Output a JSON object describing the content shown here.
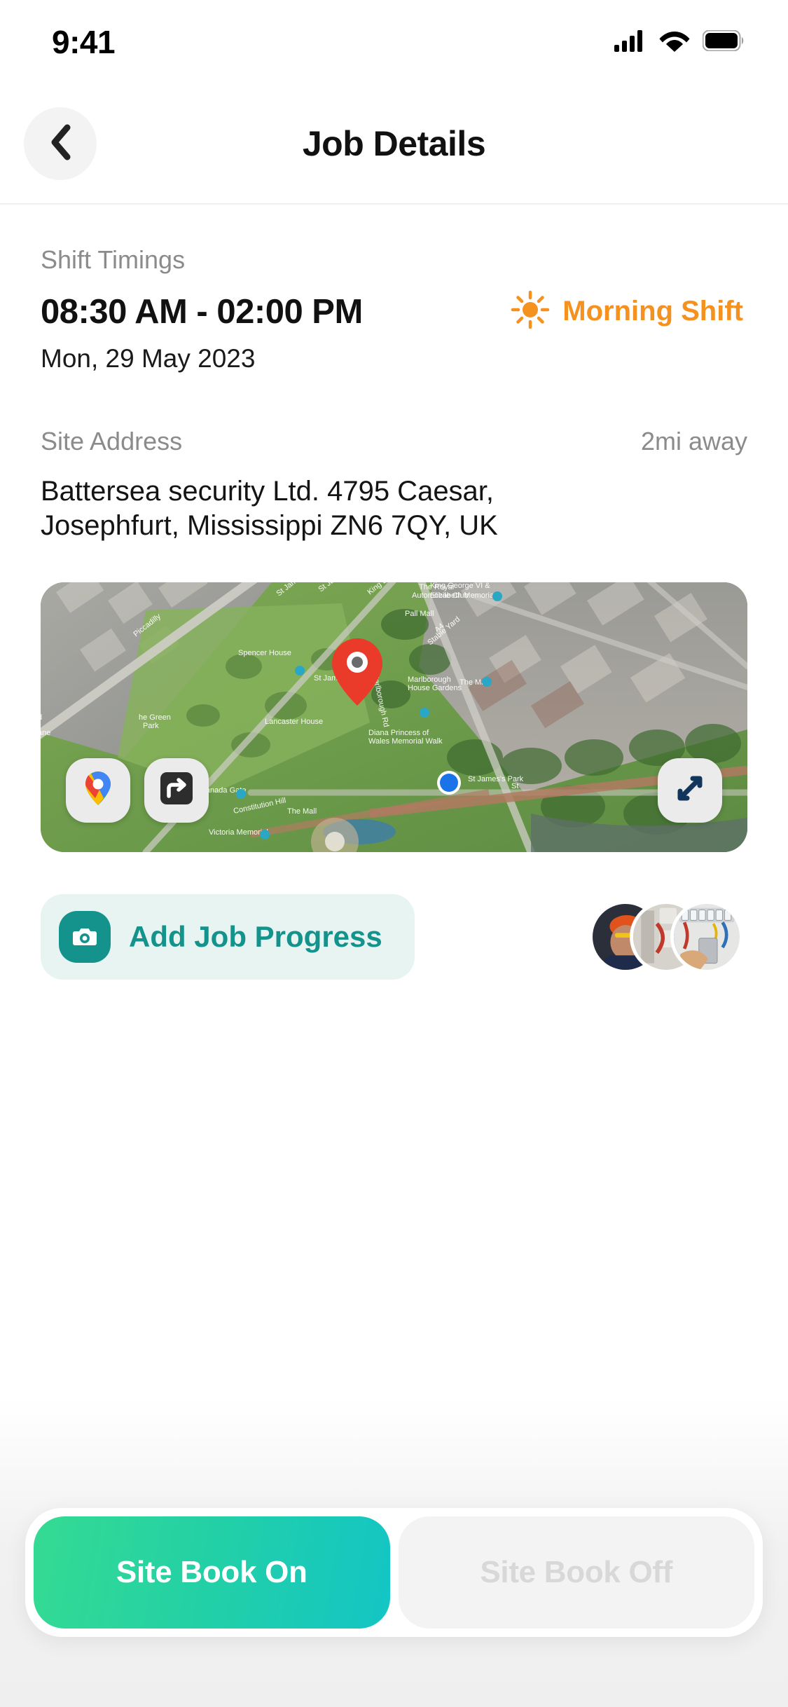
{
  "status_bar": {
    "time": "9:41",
    "signal_icon": "cellular-signal-icon",
    "wifi_icon": "wifi-icon",
    "battery_icon": "battery-full-icon"
  },
  "header": {
    "back_icon": "chevron-left-icon",
    "title": "Job Details"
  },
  "shift": {
    "label": "Shift Timings",
    "time_range": "08:30 AM - 02:00 PM",
    "date": "Mon, 29 May 2023",
    "badge_text": "Morning Shift",
    "badge_icon": "sun-icon",
    "badge_color": "#F5911E"
  },
  "address": {
    "label": "Site Address",
    "distance": "2mi away",
    "line1": "Battersea security Ltd. 4795 Caesar,",
    "line2": "Josephfurt, Mississippi ZN6 7QY, UK"
  },
  "map": {
    "type": "satellite",
    "marker_icon": "location-pin-icon",
    "user_location_icon": "blue-dot-icon",
    "labels": [
      "Piccadilly",
      "Spencer House",
      "St James's Pl",
      "St James's St",
      "King St",
      "St James's Palace",
      "Lancaster House",
      "Marlborough Road",
      "Marlborough House Gardens",
      "The Mall",
      "Pall Mall",
      "Diana Princess of Wales Memorial Walk",
      "Canada Gate",
      "Constitution Hill",
      "Victoria Memorial",
      "St James's Park",
      "The Royal Automobile Club",
      "King George VI & Queen Elizabeth Memorial",
      "Stable Yard",
      "Green Park",
      "Park Lane"
    ],
    "buttons": [
      {
        "name": "google-maps-button",
        "icon": "google-maps-pin-icon"
      },
      {
        "name": "directions-button",
        "icon": "directions-arrow-icon"
      },
      {
        "name": "expand-map-button",
        "icon": "expand-diagonal-icon"
      }
    ]
  },
  "progress": {
    "button_label": "Add Job Progress",
    "button_icon": "camera-icon",
    "accent_color": "#13938C",
    "background_color": "#E7F4F2",
    "thumbnails": [
      {
        "name": "job-photo-thumbnail",
        "alt": "worker in hard hat"
      },
      {
        "name": "job-photo-thumbnail",
        "alt": "electrical panel wiring"
      },
      {
        "name": "job-photo-thumbnail",
        "alt": "hand holding circuit breaker"
      }
    ]
  },
  "bottom_bar": {
    "book_on_label": "Site Book On",
    "book_off_label": "Site Book Off",
    "book_on_enabled": true,
    "book_off_enabled": false,
    "book_on_gradient_start": "#35DB92",
    "book_on_gradient_end": "#13C5C5"
  }
}
